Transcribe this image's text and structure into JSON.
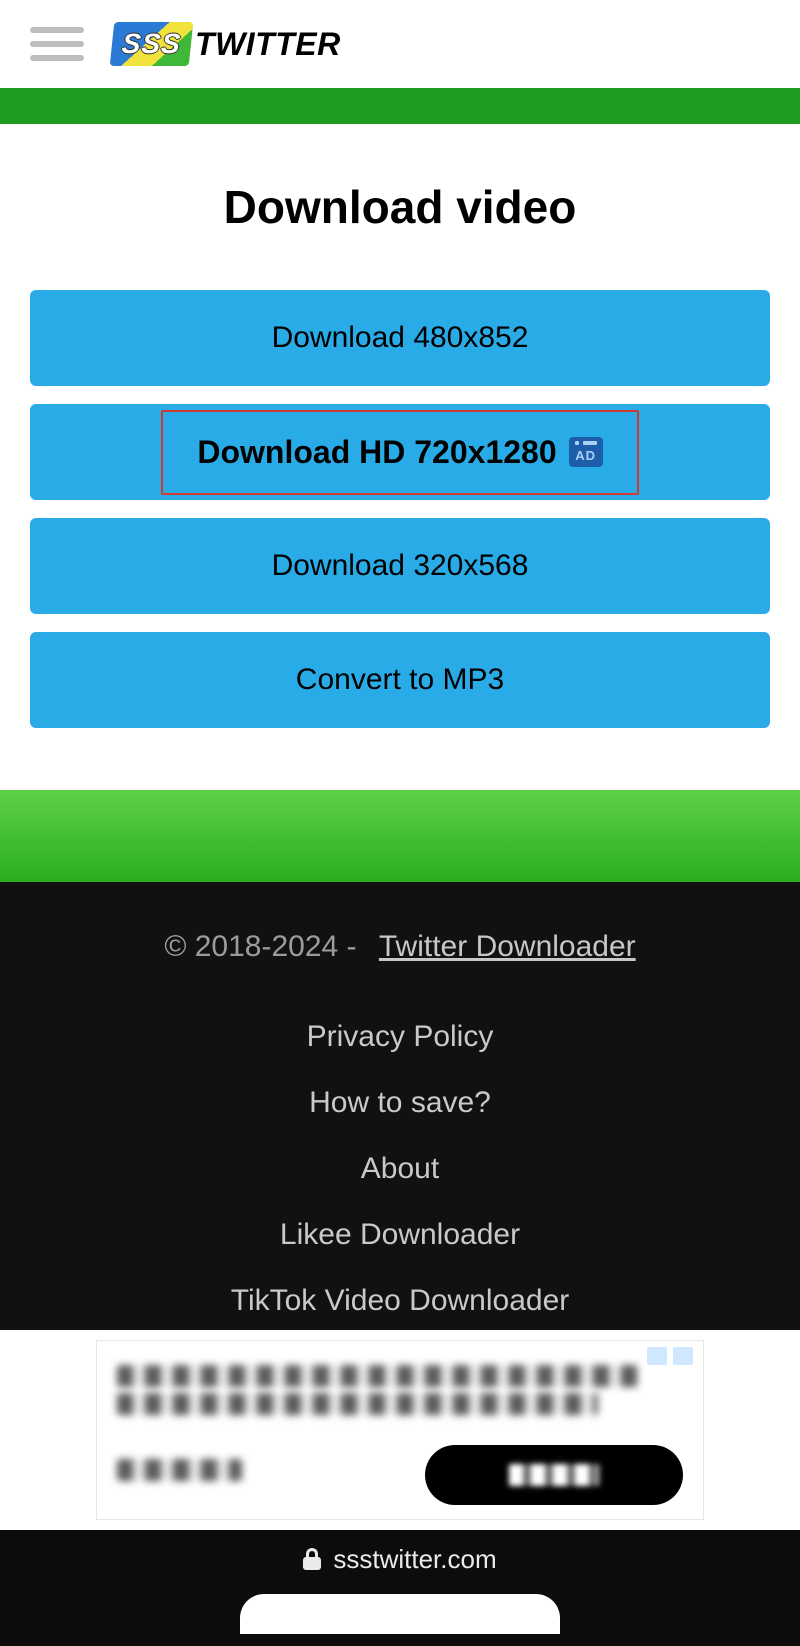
{
  "header": {
    "logo_badge": "SSS",
    "logo_text": "TWITTER"
  },
  "main": {
    "title": "Download video",
    "buttons": {
      "b480": "Download 480x852",
      "hd": "Download HD 720x1280",
      "hd_ad_badge": "AD",
      "b320": "Download 320x568",
      "mp3": "Convert to MP3"
    }
  },
  "footer": {
    "copyright_prefix": "© 2018-2024 -",
    "copyright_link": "Twitter Downloader",
    "links": {
      "privacy": "Privacy Policy",
      "howto": "How to save?",
      "about": "About",
      "likee": "Likee Downloader",
      "tiktok": "TikTok Video Downloader"
    }
  },
  "url_bar": {
    "domain": "ssstwitter.com"
  }
}
